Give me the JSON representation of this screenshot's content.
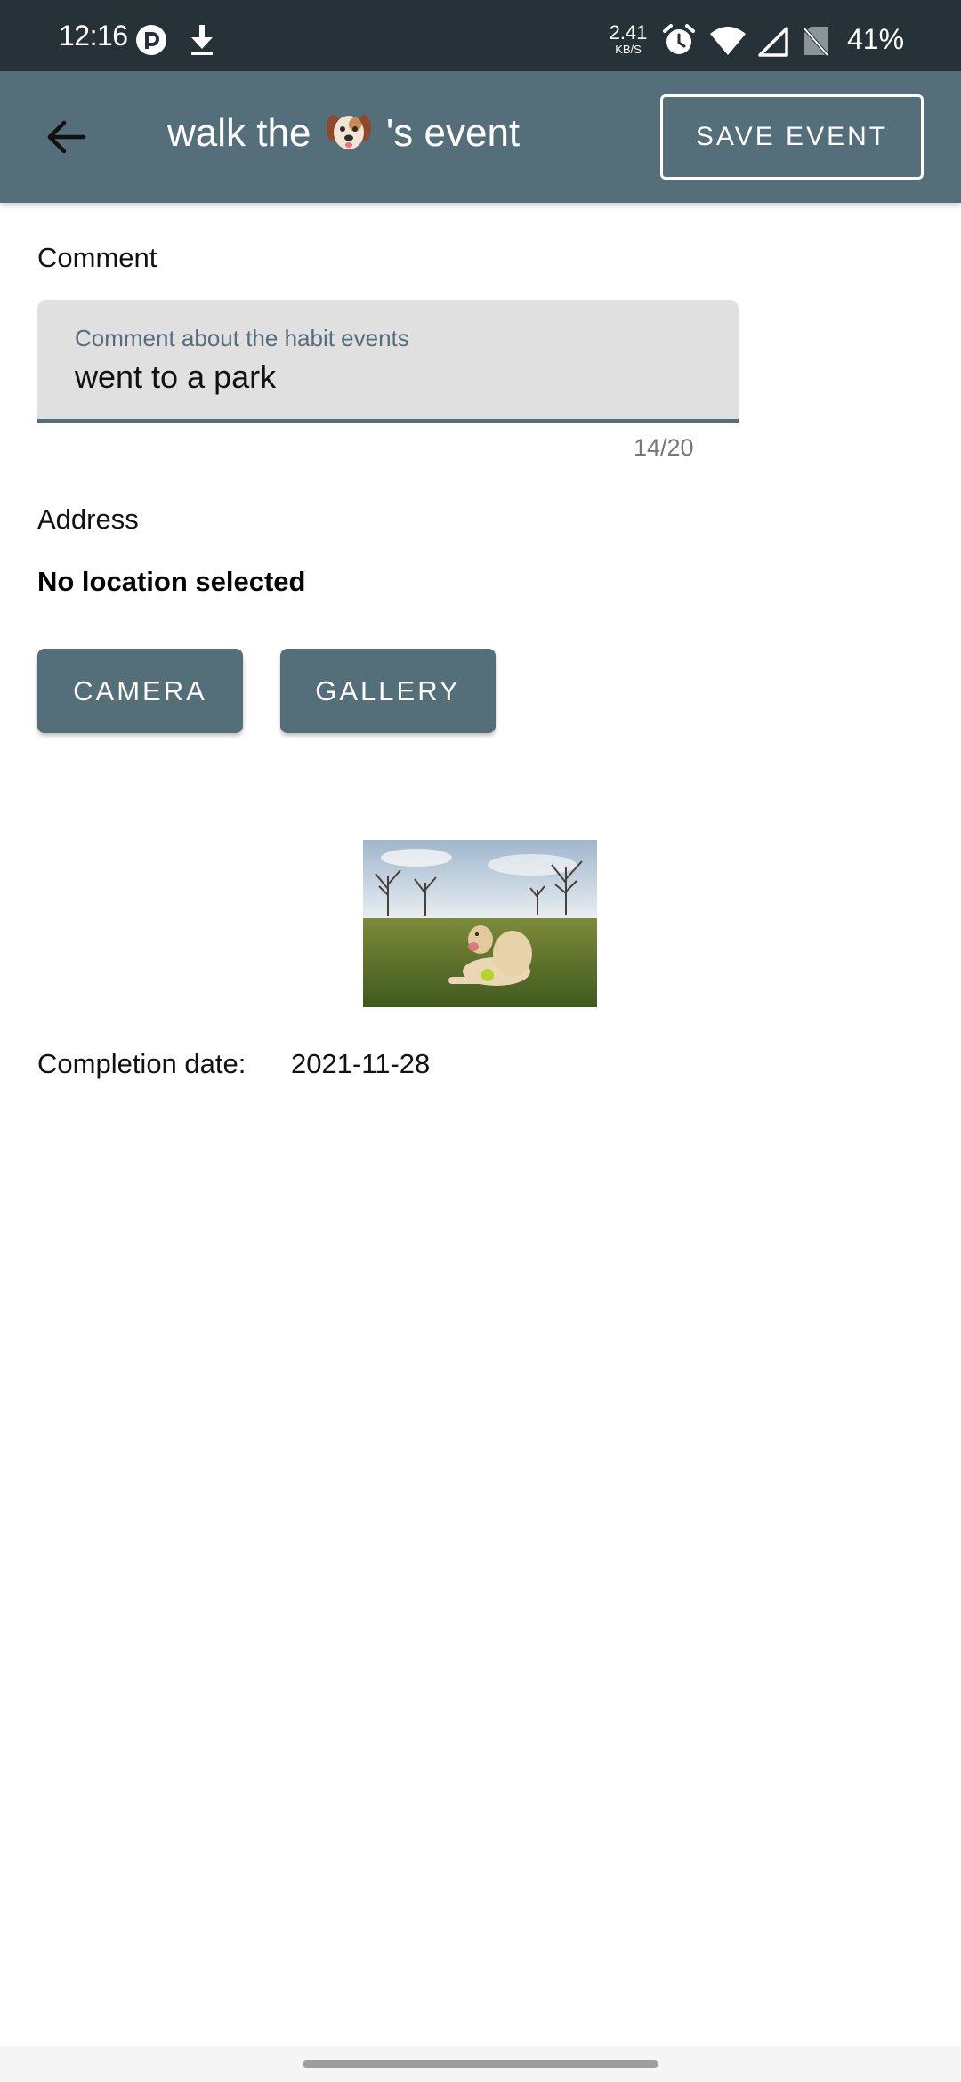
{
  "status_bar": {
    "time": "12:16",
    "net_speed_value": "2.41",
    "net_speed_unit": "KB/S",
    "battery": "41%",
    "icons": [
      "pocket-icon",
      "download-icon",
      "alarm-icon",
      "wifi-icon",
      "signal-icon",
      "no-sim-icon"
    ]
  },
  "app_bar": {
    "title_prefix": "walk the",
    "title_emoji": "dog-face-icon",
    "title_suffix": "'s event",
    "save_label": "SAVE EVENT",
    "back_icon": "arrow-back-icon"
  },
  "comment": {
    "section_label": "Comment",
    "field_label": "Comment about the habit events",
    "value": "went to a park",
    "counter": "14/20"
  },
  "address": {
    "section_label": "Address",
    "value": "No location selected"
  },
  "buttons": {
    "camera_label": "CAMERA",
    "gallery_label": "GALLERY"
  },
  "completion": {
    "label": "Completion date:",
    "value": "2021-11-28"
  },
  "colors": {
    "primary": "#546e7a",
    "status_bar": "#263238",
    "field_background": "#e0e0e0"
  }
}
